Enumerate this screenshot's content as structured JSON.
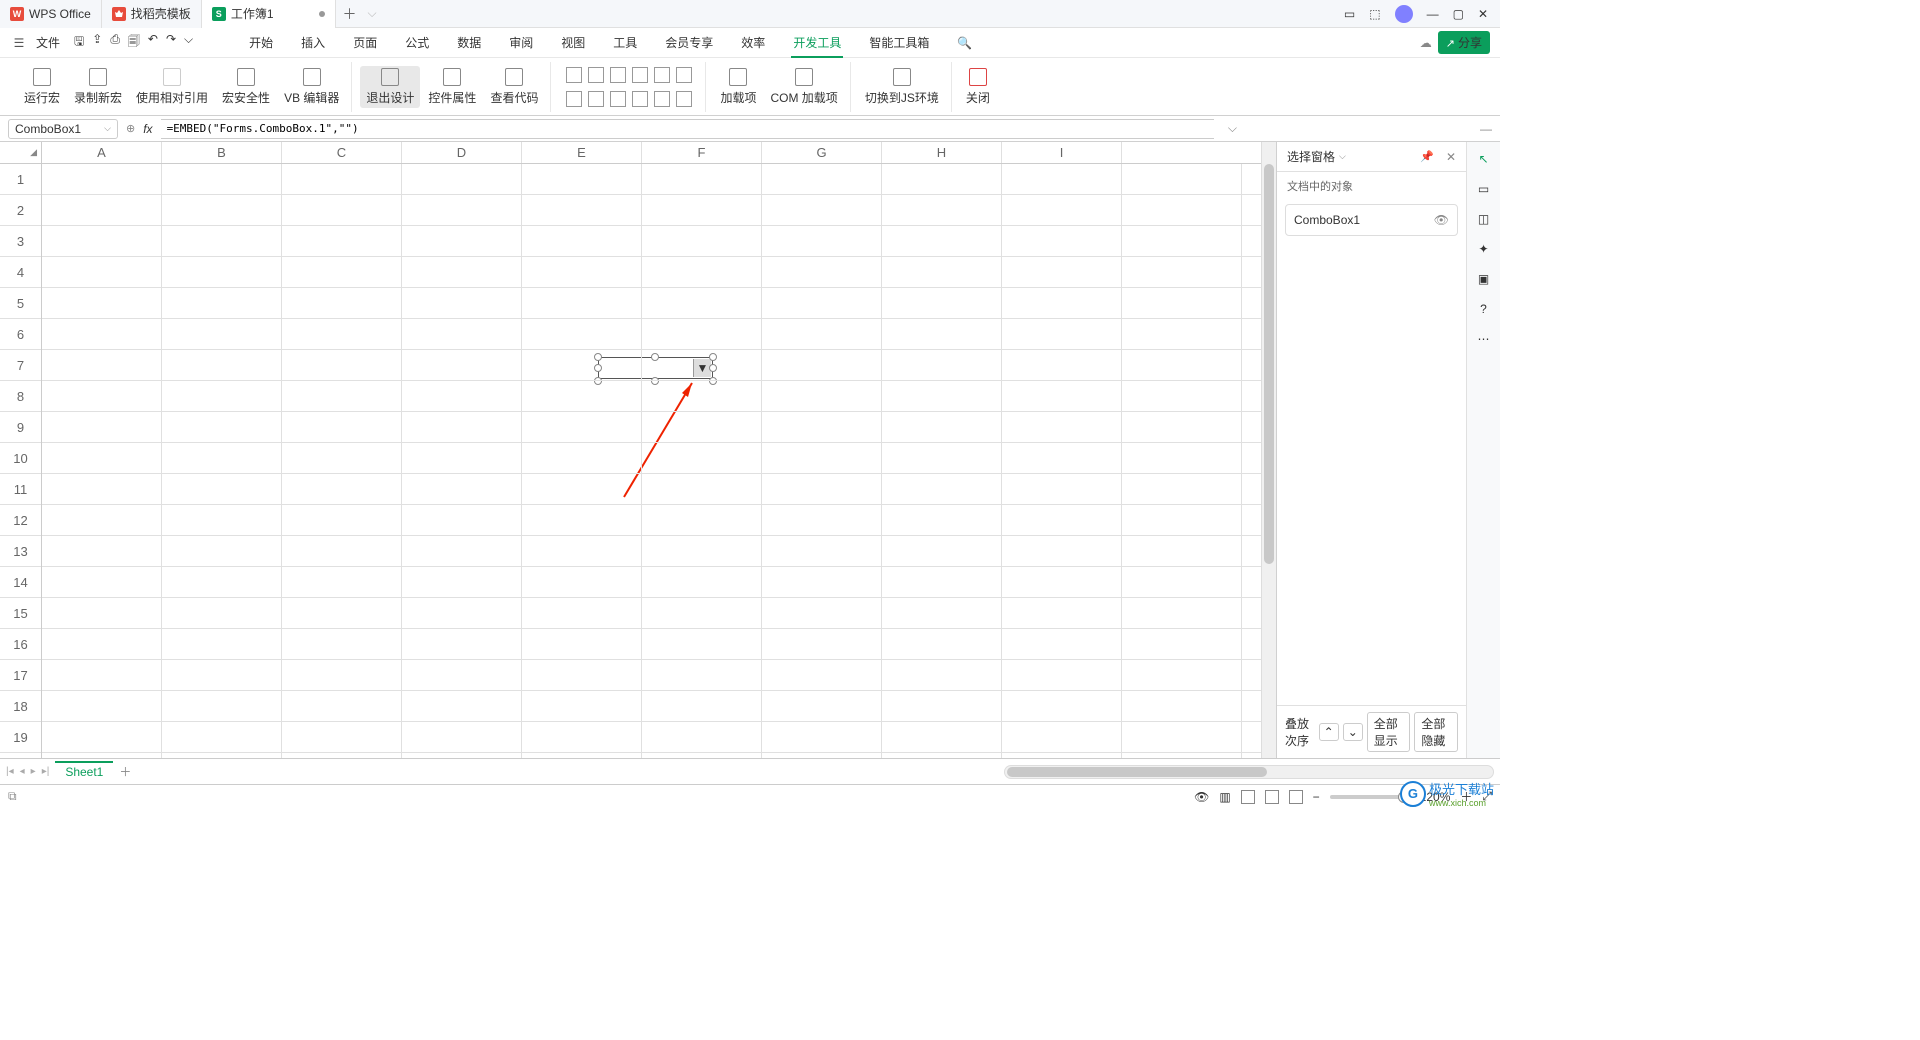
{
  "tabs": {
    "t1": "WPS Office",
    "t2": "找稻壳模板",
    "t3": "工作簿1"
  },
  "file_label": "文件",
  "menu": [
    "开始",
    "插入",
    "页面",
    "公式",
    "数据",
    "审阅",
    "视图",
    "工具",
    "会员专享",
    "效率",
    "开发工具",
    "智能工具箱"
  ],
  "active_menu": 10,
  "share": "分享",
  "ribbon": {
    "g1": [
      "运行宏",
      "录制新宏",
      "使用相对引用",
      "宏安全性",
      "VB 编辑器"
    ],
    "g2": [
      "退出设计",
      "控件属性",
      "查看代码"
    ],
    "g3": [
      "加载项",
      "COM 加载项"
    ],
    "g4": "切换到JS环境",
    "g5": "关闭"
  },
  "namebox": "ComboBox1",
  "formula": "=EMBED(\"Forms.ComboBox.1\",\"\")",
  "cols": [
    "A",
    "B",
    "C",
    "D",
    "E",
    "F",
    "G",
    "H",
    "I"
  ],
  "rows": [
    "1",
    "2",
    "3",
    "4",
    "5",
    "6",
    "7",
    "8",
    "9",
    "10",
    "11",
    "12",
    "13",
    "14",
    "15",
    "16",
    "17",
    "18",
    "19"
  ],
  "side": {
    "title": "选择窗格",
    "sub": "文档中的对象",
    "item": "ComboBox1",
    "stack": "叠放次序",
    "show_all": "全部显示",
    "hide_all": "全部隐藏"
  },
  "sheet": "Sheet1",
  "zoom": "220%",
  "watermark": {
    "brand": "极光下载站",
    "url": "www.xich.com"
  }
}
